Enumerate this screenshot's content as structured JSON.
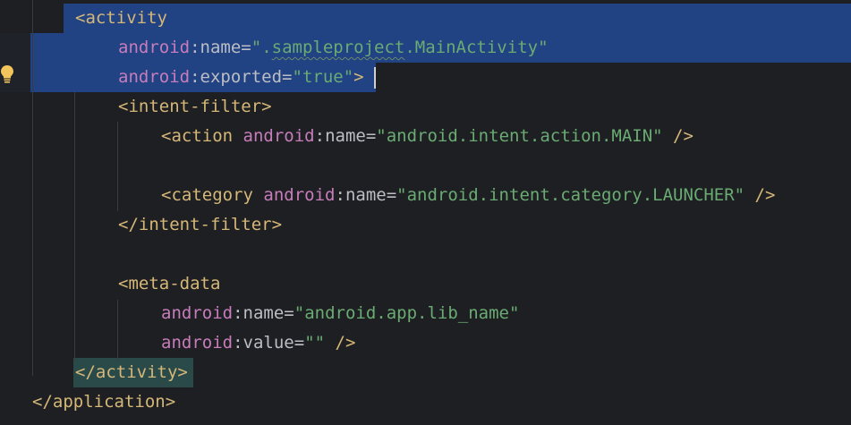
{
  "editor": {
    "lines": [
      {
        "open": "<",
        "tag": "activity"
      },
      {
        "attr_ns": "android",
        "attr": "name",
        "value": "\".sampleproject.MainActivity\""
      },
      {
        "attr_ns": "android",
        "attr": "exported",
        "value": "\"true\"",
        "close": ">"
      },
      {
        "open": "<",
        "tag": "intent-filter",
        "close": ">"
      },
      {
        "open": "<",
        "tag": "action",
        "attr_ns": "android",
        "attr": "name",
        "value": "\"android.intent.action.MAIN\"",
        "close": " />"
      },
      {
        "open": "<",
        "tag": "category",
        "attr_ns": "android",
        "attr": "name",
        "value": "\"android.intent.category.LAUNCHER\"",
        "close": " />"
      },
      {
        "open": "</",
        "tag": "intent-filter",
        "close": ">"
      },
      {
        "open": "<",
        "tag": "meta-data"
      },
      {
        "attr_ns": "android",
        "attr": "name",
        "value": "\"android.app.lib_name\""
      },
      {
        "attr_ns": "android",
        "attr": "value",
        "value": "\"\"",
        "close": " />"
      },
      {
        "open": "</",
        "tag": "activity",
        "close": ">"
      },
      {
        "open": "</",
        "tag": "application",
        "close": ">"
      }
    ],
    "intention_icon": "lightbulb-icon",
    "colors": {
      "background": "#1e1f22",
      "selection": "#214283",
      "tag": "#d5b778",
      "attribute_namespace": "#c77dbb",
      "string": "#6aab73",
      "text": "#bcbec4"
    }
  }
}
